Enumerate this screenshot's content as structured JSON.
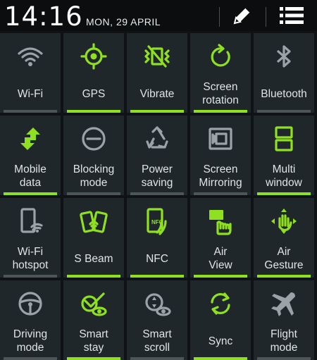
{
  "status": {
    "time": "14:16",
    "date": "MON, 29 APRIL"
  },
  "colors": {
    "accent": "#8fe020",
    "inactive_icon": "#9aa3a8",
    "tile_bg": "#1f272b",
    "off_bar": "#4d5559"
  },
  "tiles": [
    {
      "label": "Wi-Fi",
      "icon": "wifi-icon",
      "on": false
    },
    {
      "label": "GPS",
      "icon": "gps-icon",
      "on": true
    },
    {
      "label": "Vibrate",
      "icon": "vibrate-icon",
      "on": true
    },
    {
      "label": "Screen\nrotation",
      "icon": "rotation-icon",
      "on": true
    },
    {
      "label": "Bluetooth",
      "icon": "bluetooth-icon",
      "on": false
    },
    {
      "label": "Mobile\ndata",
      "icon": "mobile-data-icon",
      "on": true
    },
    {
      "label": "Blocking\nmode",
      "icon": "blocking-icon",
      "on": false
    },
    {
      "label": "Power\nsaving",
      "icon": "recycle-icon",
      "on": false
    },
    {
      "label": "Screen\nMirroring",
      "icon": "screen-mirroring-icon",
      "on": false
    },
    {
      "label": "Multi\nwindow",
      "icon": "multi-window-icon",
      "on": true
    },
    {
      "label": "Wi-Fi\nhotspot",
      "icon": "hotspot-icon",
      "on": false
    },
    {
      "label": "S Beam",
      "icon": "s-beam-icon",
      "on": true
    },
    {
      "label": "NFC",
      "icon": "nfc-icon",
      "on": true
    },
    {
      "label": "Air\nView",
      "icon": "air-view-icon",
      "on": true
    },
    {
      "label": "Air\nGesture",
      "icon": "air-gesture-icon",
      "on": true
    },
    {
      "label": "Driving\nmode",
      "icon": "steering-wheel-icon",
      "on": false
    },
    {
      "label": "Smart\nstay",
      "icon": "smart-stay-icon",
      "on": true
    },
    {
      "label": "Smart\nscroll",
      "icon": "smart-scroll-icon",
      "on": false
    },
    {
      "label": "Sync",
      "icon": "sync-icon",
      "on": true
    },
    {
      "label": "Flight\nmode",
      "icon": "airplane-icon",
      "on": false
    }
  ]
}
